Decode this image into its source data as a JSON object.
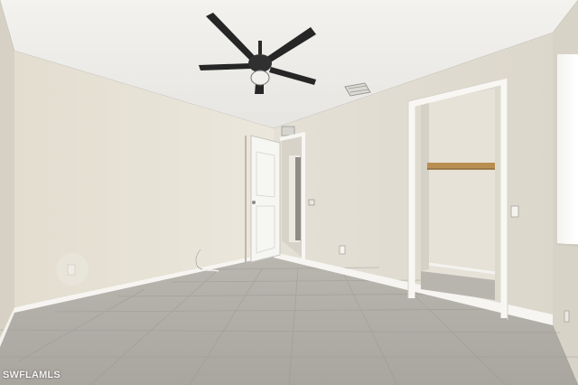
{
  "photo": {
    "watermark": "SWFLAMLS"
  }
}
